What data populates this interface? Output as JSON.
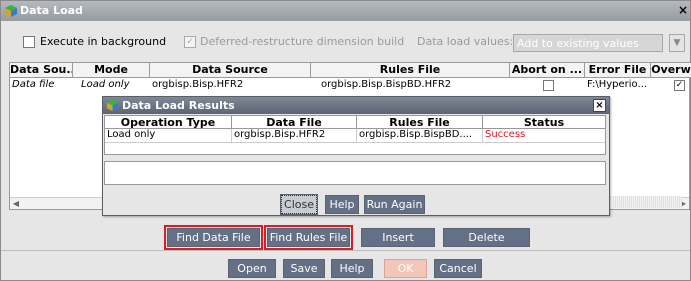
{
  "window": {
    "title": "Data Load",
    "close_glyph": "×"
  },
  "options": {
    "execute_background": "Execute in background",
    "deferred_restructure": "Deferred-restructure dimension build",
    "deferred_check": "✓",
    "data_load_values_label": "Data load values:",
    "data_load_values_selected": "Add to existing values",
    "dropdown_glyph": "▼"
  },
  "grid": {
    "headers": [
      "Data Sou...",
      "Mode",
      "Data Source",
      "Rules File",
      "Abort on ...",
      "Error File",
      "Overw"
    ],
    "row": {
      "data_source_type": "Data file",
      "mode": "Load only",
      "data_source": "orgbisp.Bisp.HFR2",
      "rules_file": "orgbisp.Bisp.BispBD.HFR2",
      "error_file": "F:\\Hyperio...",
      "overwrite_check": "✓"
    },
    "scroll_left": "◀",
    "scroll_right": "▶"
  },
  "dialog": {
    "title": "Data Load Results",
    "close_glyph": "×",
    "headers": [
      "Operation Type",
      "Data File",
      "Rules File",
      "Status"
    ],
    "row": {
      "operation_type": "Load only",
      "data_file": "orgbisp.Bisp.HFR2",
      "rules_file": "orgbisp.Bisp.BispBD....",
      "status": "Success"
    },
    "buttons": {
      "close": "Close",
      "help": "Help",
      "run_again": "Run Again"
    }
  },
  "actions": {
    "find_data_file": "Find Data File",
    "find_rules_file": "Find Rules File",
    "insert": "Insert",
    "delete": "Delete"
  },
  "footer": {
    "open": "Open",
    "save": "Save",
    "help": "Help",
    "ok": "OK",
    "cancel": "Cancel"
  },
  "colors": {
    "status_success": "#e0141e",
    "highlight": "#d41e2a",
    "button": "#637085"
  }
}
